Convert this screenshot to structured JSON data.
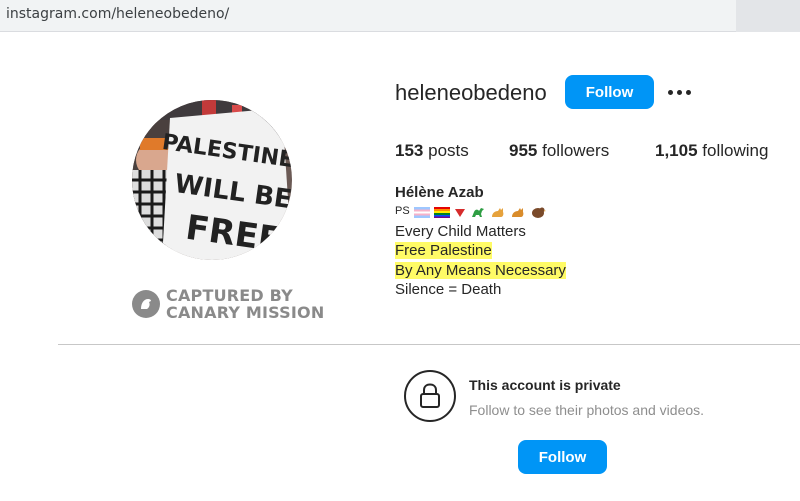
{
  "browser": {
    "url": "instagram.com/heleneobedeno/"
  },
  "profile": {
    "username": "heleneobedeno",
    "follow_label": "Follow",
    "more_icon": "more-horizontal-icon",
    "stats": {
      "posts_count": "153",
      "posts_label": "posts",
      "followers_count": "955",
      "followers_label": "followers",
      "following_count": "1,105",
      "following_label": "following"
    },
    "avatar_sign_text": "PALESTINE WILL BE FREE",
    "bio": {
      "name": "Hélène Azab",
      "emoji_line": {
        "prefix": "PS",
        "emojis": [
          "flag-icon",
          "rainbow-flag-icon",
          "red-triangle-icon",
          "dinosaur-icon",
          "cat-icon",
          "cat-icon",
          "bird-icon"
        ]
      },
      "lines": [
        "Every Child Matters",
        "Free Palestine",
        "By Any Means Necessary",
        "Silence = Death"
      ],
      "highlight_color": "#fffb66"
    }
  },
  "watermark": {
    "line1": "CAPTURED BY",
    "line2": "CANARY MISSION",
    "icon": "canary-bird-icon"
  },
  "private_notice": {
    "title": "This account is private",
    "subtitle": "Follow to see their photos and videos.",
    "follow_label": "Follow",
    "icon": "lock-icon"
  },
  "colors": {
    "accent": "#0095f6",
    "text": "#262626",
    "muted": "#8e8e8e"
  }
}
